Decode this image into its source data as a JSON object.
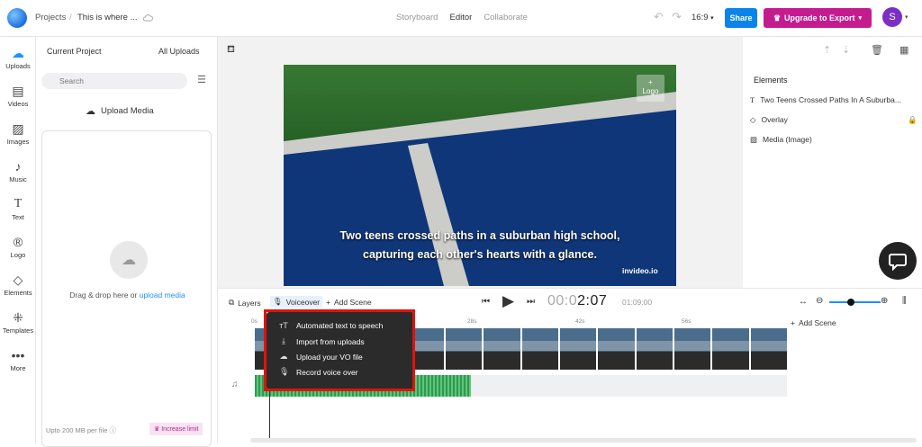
{
  "header": {
    "breadcrumb_root": "Projects",
    "separator": "/",
    "project_title": "This is where ...",
    "tabs": [
      "Storyboard",
      "Editor",
      "Collaborate"
    ],
    "active_tab": "Editor",
    "aspect_ratio": "16:9",
    "share_label": "Share",
    "upgrade_label": "Upgrade to Export",
    "avatar_initial": "S"
  },
  "rail": {
    "items": [
      {
        "label": "Uploads",
        "icon": "upload-cloud-icon",
        "active": true
      },
      {
        "label": "Videos",
        "icon": "film-icon"
      },
      {
        "label": "Images",
        "icon": "image-icon"
      },
      {
        "label": "Music",
        "icon": "music-note-icon"
      },
      {
        "label": "Text",
        "icon": "text-t-icon"
      },
      {
        "label": "Logo",
        "icon": "registered-icon"
      },
      {
        "label": "Elements",
        "icon": "shapes-icon"
      },
      {
        "label": "Templates",
        "icon": "grid-icon"
      },
      {
        "label": "More",
        "icon": "ellipsis-icon"
      }
    ]
  },
  "panel": {
    "tab_current": "Current Project",
    "tab_all": "All Uploads",
    "search_placeholder": "Search",
    "upload_label": "Upload Media",
    "drop_text": "Drag & drop here or ",
    "drop_link": "upload media",
    "limit_text": "Upto 200 MB per file",
    "increase_label": "Increase limit"
  },
  "canvas": {
    "logo_label": "Logo",
    "caption_line1": "Two teens crossed paths in a suburban high school,",
    "caption_line2": "capturing each other's hearts with a glance.",
    "watermark": "invideo.io"
  },
  "elements_panel": {
    "title": "Elements",
    "items": [
      {
        "label": "Two Teens Crossed Paths In A Suburba...",
        "icon": "text-icon"
      },
      {
        "label": "Overlay",
        "icon": "diamond-icon",
        "locked": true
      },
      {
        "label": "Media (Image)",
        "icon": "image-icon"
      }
    ]
  },
  "timeline": {
    "layers_label": "Layers",
    "voiceover_label": "Voiceover",
    "add_scene_label": "Add Scene",
    "time_dim": "00:0",
    "time_main": "2:07",
    "total_time": "01:09:00",
    "ruler_ticks": [
      "0s",
      "28s",
      "42s",
      "56s"
    ],
    "add_scene_right": "Add Scene"
  },
  "voiceover_menu": {
    "items": [
      {
        "label": "Automated text to speech",
        "icon": "text-speech-icon"
      },
      {
        "label": "Import from uploads",
        "icon": "download-icon"
      },
      {
        "label": "Upload your VO file",
        "icon": "cloud-upload-icon"
      },
      {
        "label": "Record voice over",
        "icon": "microphone-icon"
      }
    ]
  },
  "colors": {
    "accent_blue": "#0a84e8",
    "upgrade_magenta": "#c41c8e",
    "highlight_red": "#e3120b"
  }
}
